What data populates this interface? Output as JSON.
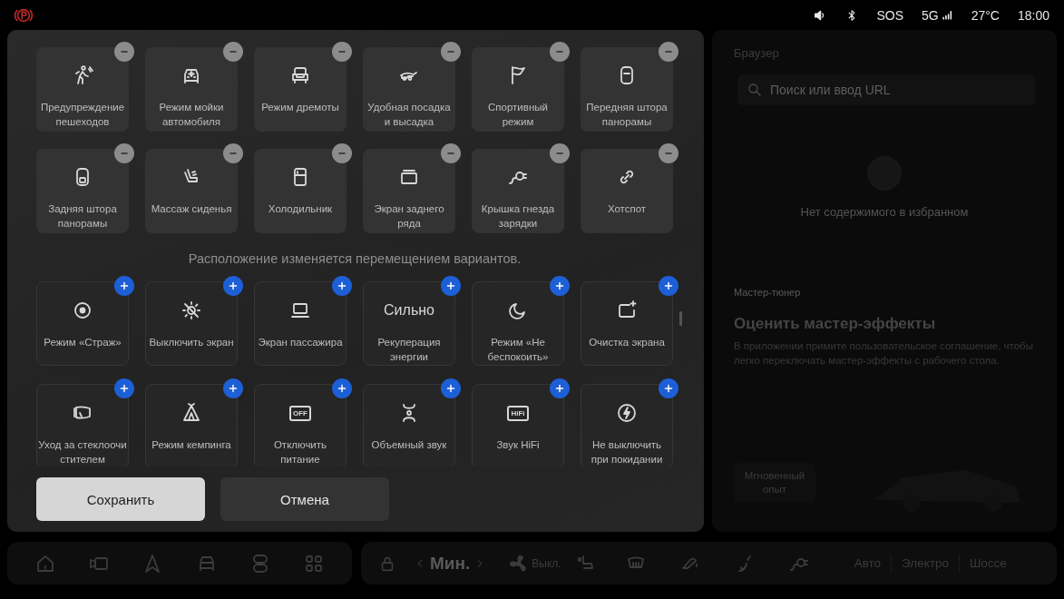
{
  "status_bar": {
    "sos": "SOS",
    "network": "5G",
    "temperature": "27°C",
    "time": "18:00"
  },
  "editor": {
    "active_tiles": [
      {
        "label": "Предупреждение пешеходов",
        "added": true
      },
      {
        "label": "Режим мойки автомобиля",
        "added": true
      },
      {
        "label": "Режим дремоты",
        "added": true
      },
      {
        "label": "Удобная посадка и высадка",
        "added": true
      },
      {
        "label": "Спортивный режим",
        "added": true
      },
      {
        "label": "Передняя штора панорамы",
        "added": true
      },
      {
        "label": "Задняя штора панорамы",
        "added": true
      },
      {
        "label": "Массаж сиденья",
        "added": true
      },
      {
        "label": "Холодильник",
        "added": true
      },
      {
        "label": "Экран заднего ряда",
        "added": true
      },
      {
        "label": "Крышка гнезда зарядки",
        "added": true
      },
      {
        "label": "Хотспот",
        "added": true
      }
    ],
    "hint": "Расположение изменяется перемещением вариантов.",
    "available_tiles": [
      {
        "label": "Режим «Страж»",
        "added": false
      },
      {
        "label": "Выключить экран",
        "added": false
      },
      {
        "label": "Экран пассажира",
        "added": false
      },
      {
        "label": "Рекуперация энергии",
        "value": "Сильно",
        "added": false
      },
      {
        "label": "Режим «Не беспокоить»",
        "added": false
      },
      {
        "label": "Очистка экрана",
        "added": false
      },
      {
        "label": "Уход за стеклоочи стителем",
        "added": false
      },
      {
        "label": "Режим кемпинга",
        "added": false
      },
      {
        "label": "Отключить питание",
        "icon_text": "OFF",
        "added": false
      },
      {
        "label": "Объемный звук",
        "added": false
      },
      {
        "label": "Звук HiFi",
        "icon_text": "HiFi",
        "added": false
      },
      {
        "label": "Не выключить при покидании",
        "added": false
      }
    ],
    "buttons": [
      {
        "label": "Сохранить",
        "kind": "primary"
      },
      {
        "label": "Отмена",
        "kind": "secondary"
      }
    ]
  },
  "browser_card": {
    "title": "Браузер",
    "search": {
      "placeholder": "Поиск или ввод URL"
    },
    "empty_message": "Нет содержимого в избранном",
    "section": "Мастер-тюнер",
    "heading": "Оценить мастер-эффекты",
    "description": "В приложении примите пользовательское соглашение, чтобы легко переключать мастер-эффекты с рабочего стола.",
    "button": "Мгновенный опыт"
  },
  "dock": {
    "fan_speed": "Мин.",
    "fan_state": "Выкл.",
    "drive_modes": [
      "Авто",
      "Электро",
      "Шоссе"
    ]
  }
}
